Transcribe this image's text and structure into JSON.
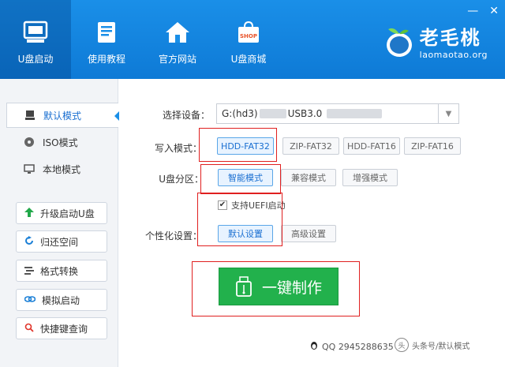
{
  "window": {
    "minimize_glyph": "—",
    "close_glyph": "✕"
  },
  "top_nav": {
    "items": [
      {
        "label": "U盘启动",
        "icon": "usb-drive-icon",
        "active": true
      },
      {
        "label": "使用教程",
        "icon": "book-icon",
        "active": false
      },
      {
        "label": "官方网站",
        "icon": "home-icon",
        "active": false
      },
      {
        "label": "U盘商城",
        "icon": "shop-bag-icon",
        "active": false
      }
    ],
    "shop_badge": "SHOP"
  },
  "brand": {
    "title": "老毛桃",
    "url": "laomaotao.org"
  },
  "sidebar": {
    "modes": [
      {
        "label": "默认模式",
        "icon": "usb-icon",
        "active": true
      },
      {
        "label": "ISO模式",
        "icon": "disc-icon",
        "active": false
      },
      {
        "label": "本地模式",
        "icon": "monitor-icon",
        "active": false
      }
    ],
    "tools": [
      {
        "label": "升级启动U盘",
        "icon": "arrow-up-icon"
      },
      {
        "label": "归还空间",
        "icon": "refresh-icon"
      },
      {
        "label": "格式转换",
        "icon": "convert-icon"
      },
      {
        "label": "模拟启动",
        "icon": "link-icon"
      },
      {
        "label": "快捷键查询",
        "icon": "search-icon"
      }
    ]
  },
  "form": {
    "device_label": "选择设备：",
    "device_value_prefix": "G:(hd3)",
    "device_value_mid": "USB3.0",
    "write_mode_label": "写入模式：",
    "write_modes": [
      {
        "label": "HDD-FAT32",
        "selected": true
      },
      {
        "label": "ZIP-FAT32",
        "selected": false
      },
      {
        "label": "HDD-FAT16",
        "selected": false
      },
      {
        "label": "ZIP-FAT16",
        "selected": false
      }
    ],
    "partition_label": "U盘分区：",
    "partition_modes": [
      {
        "label": "智能模式",
        "selected": true
      },
      {
        "label": "兼容模式",
        "selected": false
      },
      {
        "label": "增强模式",
        "selected": false
      }
    ],
    "uefi_label": "支持UEFI启动",
    "uefi_checked": true,
    "personalize_label": "个性化设置：",
    "personalize_options": [
      {
        "label": "默认设置",
        "selected": true
      },
      {
        "label": "高级设置",
        "selected": false
      }
    ]
  },
  "make_button": {
    "label": "一键制作"
  },
  "footer": {
    "qq_text": "QQ 2945288635"
  },
  "watermark": {
    "text": "头条号/默认模式"
  },
  "colors": {
    "header_blue": "#1a8fe8",
    "make_green": "#22b14c",
    "highlight_red": "#e02020",
    "selected_blue": "#1a6fd1"
  }
}
